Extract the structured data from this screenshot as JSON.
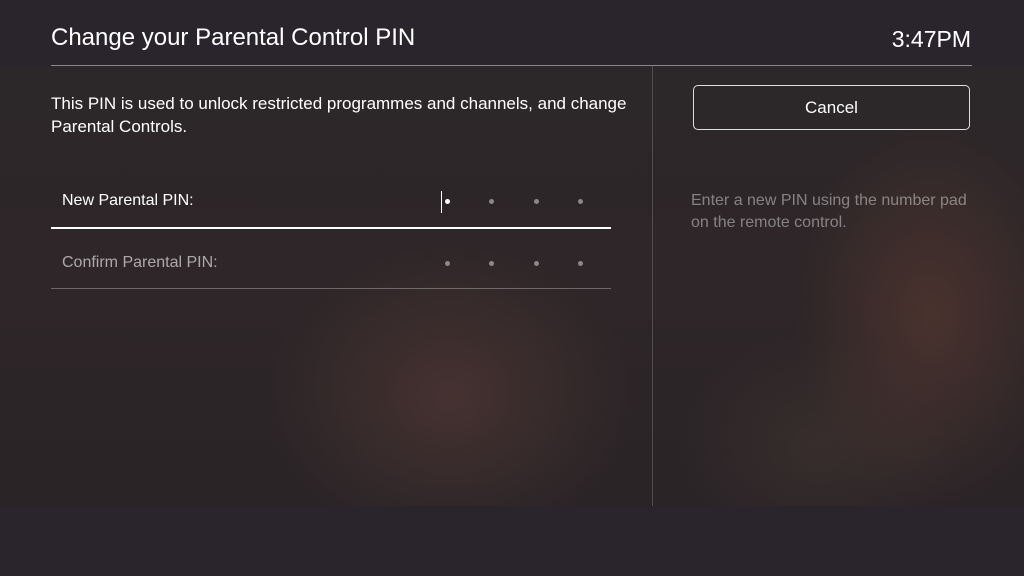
{
  "header": {
    "title": "Change your Parental Control PIN",
    "clock": "3:47PM"
  },
  "main": {
    "description": "This PIN is used to unlock restricted programmes and channels, and change Parental Controls.",
    "fields": [
      {
        "label": "New Parental PIN:",
        "pin_length": 4,
        "entered": 0,
        "focused": true
      },
      {
        "label": "Confirm Parental PIN:",
        "pin_length": 4,
        "entered": 0,
        "focused": false
      }
    ]
  },
  "sidebar": {
    "cancel_label": "Cancel",
    "help_text": "Enter a new PIN using the number pad on the remote control."
  }
}
